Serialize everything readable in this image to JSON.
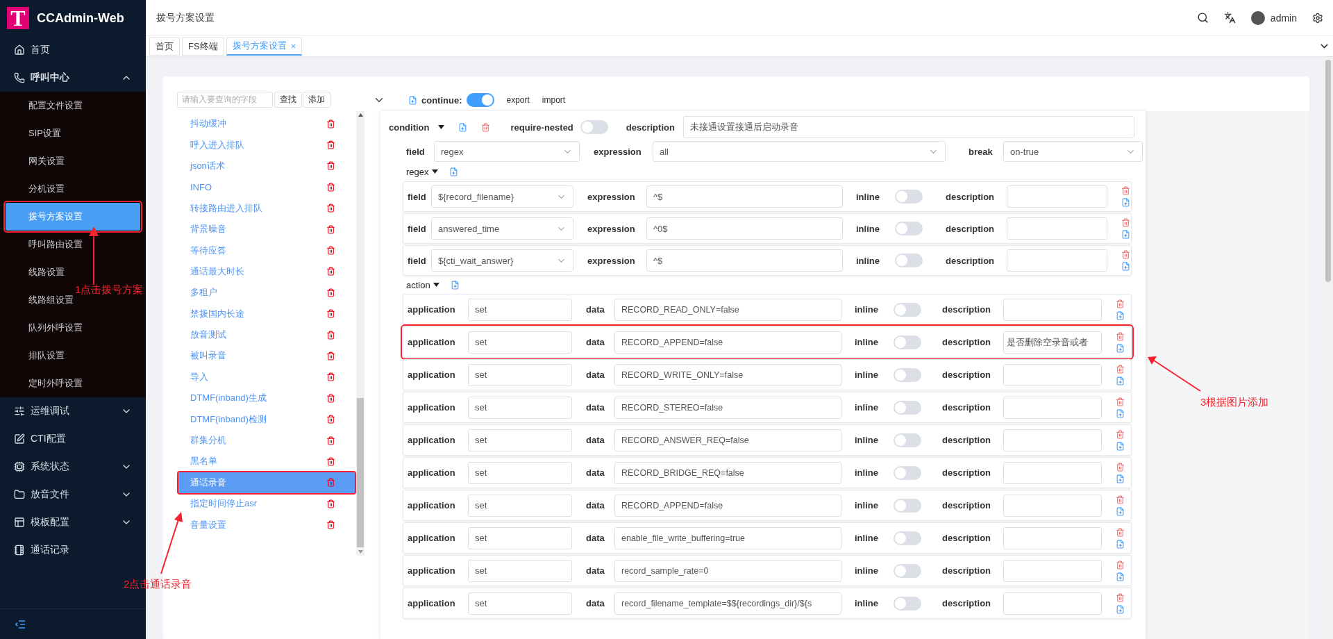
{
  "app": {
    "logo": "T",
    "title": "CCAdmin-Web"
  },
  "sidebar": {
    "items": [
      {
        "kind": "link",
        "label": "首页"
      },
      {
        "kind": "group",
        "label": "呼叫中心",
        "expanded": true,
        "children": [
          {
            "label": "配置文件设置",
            "selected": false,
            "framed": false
          },
          {
            "label": "SIP设置",
            "selected": false,
            "framed": false
          },
          {
            "label": "网关设置",
            "selected": false,
            "framed": false
          },
          {
            "label": "分机设置",
            "selected": false,
            "framed": false
          },
          {
            "label": "拨号方案设置",
            "selected": true,
            "framed": true
          },
          {
            "label": "呼叫路由设置",
            "selected": false,
            "framed": false
          },
          {
            "label": "线路设置",
            "selected": false,
            "framed": false
          },
          {
            "label": "线路组设置",
            "selected": false,
            "framed": false
          },
          {
            "label": "队列外呼设置",
            "selected": false,
            "framed": false
          },
          {
            "label": "排队设置",
            "selected": false,
            "framed": false
          },
          {
            "label": "定时外呼设置",
            "selected": false,
            "framed": false
          }
        ]
      },
      {
        "kind": "group",
        "label": "运维调试",
        "expanded": false
      },
      {
        "kind": "link",
        "label": "CTI配置"
      },
      {
        "kind": "group",
        "label": "系统状态",
        "expanded": false
      },
      {
        "kind": "group",
        "label": "放音文件",
        "expanded": false
      },
      {
        "kind": "group",
        "label": "模板配置",
        "expanded": false
      },
      {
        "kind": "link",
        "label": "通话记录"
      }
    ]
  },
  "header": {
    "title": "拨号方案设置",
    "user": "admin"
  },
  "tabs": [
    {
      "label": "首页",
      "selected": false
    },
    {
      "label": "FS终端",
      "selected": false
    },
    {
      "label": "拨号方案设置",
      "selected": true,
      "close": "×"
    }
  ],
  "list_panel": {
    "search": {
      "placeholder": "请输入要查询的字段"
    },
    "buttons": [
      "查找",
      "添加"
    ],
    "items": [
      {
        "label": "抖动缓冲",
        "selected": false,
        "framed": false
      },
      {
        "label": "呼入进入排队",
        "selected": false,
        "framed": false
      },
      {
        "label": "json话术",
        "selected": false,
        "framed": false
      },
      {
        "label": "INFO",
        "selected": false,
        "framed": false
      },
      {
        "label": "转接路由进入排队",
        "selected": false,
        "framed": false
      },
      {
        "label": "背景噪音",
        "selected": false,
        "framed": false
      },
      {
        "label": "等待应答",
        "selected": false,
        "framed": false
      },
      {
        "label": "通话最大时长",
        "selected": false,
        "framed": false
      },
      {
        "label": "多租户",
        "selected": false,
        "framed": false
      },
      {
        "label": "禁拨国内长途",
        "selected": false,
        "framed": false
      },
      {
        "label": "放音测试",
        "selected": false,
        "framed": false
      },
      {
        "label": "被叫录音",
        "selected": false,
        "framed": false
      },
      {
        "label": "导入",
        "selected": false,
        "framed": false
      },
      {
        "label": "DTMF(inband)生成",
        "selected": false,
        "framed": false
      },
      {
        "label": "DTMF(inband)检测",
        "selected": false,
        "framed": false
      },
      {
        "label": "群集分机",
        "selected": false,
        "framed": false
      },
      {
        "label": "黑名单",
        "selected": false,
        "framed": false
      },
      {
        "label": "通话录音",
        "selected": true,
        "framed": true
      },
      {
        "label": "指定时间停止asr",
        "selected": false,
        "framed": false
      },
      {
        "label": "音量设置",
        "selected": false,
        "framed": false
      }
    ]
  },
  "toolbar": {
    "continue_label": "continue:",
    "continue_on": true,
    "links": [
      "export",
      "import"
    ]
  },
  "condition": {
    "label": "condition",
    "require_nested_label": "require-nested",
    "require_nested": false,
    "description_label": "description",
    "description": "未接通设置接通后启动录音",
    "field_label": "field",
    "field": "regex",
    "expression_label": "expression",
    "expression": "all",
    "break_label": "break",
    "break": "on-true"
  },
  "regex": {
    "label": "regex",
    "rows": [
      {
        "field_label": "field",
        "field": "${record_filename}",
        "expression_label": "expression",
        "expression": "^$",
        "inline_label": "inline",
        "inline": false,
        "description_label": "description"
      },
      {
        "field_label": "field",
        "field": "answered_time",
        "expression_label": "expression",
        "expression": "^0$",
        "inline_label": "inline",
        "inline": false,
        "description_label": "description"
      },
      {
        "field_label": "field",
        "field": "${cti_wait_answer}",
        "expression_label": "expression",
        "expression": "^$",
        "inline_label": "inline",
        "inline": false,
        "description_label": "description"
      }
    ]
  },
  "action": {
    "label": "action",
    "rows": [
      {
        "application_label": "application",
        "application": "set",
        "data_label": "data",
        "data": "RECORD_READ_ONLY=false",
        "inline_label": "inline",
        "inline": false,
        "description_label": "description",
        "framed": false
      },
      {
        "application_label": "application",
        "application": "set",
        "data_label": "data",
        "data": "RECORD_APPEND=false",
        "inline_label": "inline",
        "inline": false,
        "description_label": "description",
        "description": "是否删除空录音或者",
        "framed": true
      },
      {
        "application_label": "application",
        "application": "set",
        "data_label": "data",
        "data": "RECORD_WRITE_ONLY=false",
        "inline_label": "inline",
        "inline": false,
        "description_label": "description",
        "framed": false
      },
      {
        "application_label": "application",
        "application": "set",
        "data_label": "data",
        "data": "RECORD_STEREO=false",
        "inline_label": "inline",
        "inline": false,
        "description_label": "description",
        "framed": false
      },
      {
        "application_label": "application",
        "application": "set",
        "data_label": "data",
        "data": "RECORD_ANSWER_REQ=false",
        "inline_label": "inline",
        "inline": false,
        "description_label": "description",
        "framed": false
      },
      {
        "application_label": "application",
        "application": "set",
        "data_label": "data",
        "data": "RECORD_BRIDGE_REQ=false",
        "inline_label": "inline",
        "inline": false,
        "description_label": "description",
        "framed": false
      },
      {
        "application_label": "application",
        "application": "set",
        "data_label": "data",
        "data": "RECORD_APPEND=false",
        "inline_label": "inline",
        "inline": false,
        "description_label": "description",
        "framed": false
      },
      {
        "application_label": "application",
        "application": "set",
        "data_label": "data",
        "data": "enable_file_write_buffering=true",
        "inline_label": "inline",
        "inline": false,
        "description_label": "description",
        "framed": false
      },
      {
        "application_label": "application",
        "application": "set",
        "data_label": "data",
        "data": "record_sample_rate=0",
        "inline_label": "inline",
        "inline": false,
        "description_label": "description",
        "framed": false
      },
      {
        "application_label": "application",
        "application": "set",
        "data_label": "data",
        "data": "record_filename_template=$${recordings_dir}/${s",
        "inline_label": "inline",
        "inline": false,
        "description_label": "description",
        "framed": false
      }
    ]
  },
  "annotations": [
    {
      "text": "1点击拨号方案"
    },
    {
      "text": "2点击通话录音"
    },
    {
      "text": "3根据图片添加"
    }
  ]
}
